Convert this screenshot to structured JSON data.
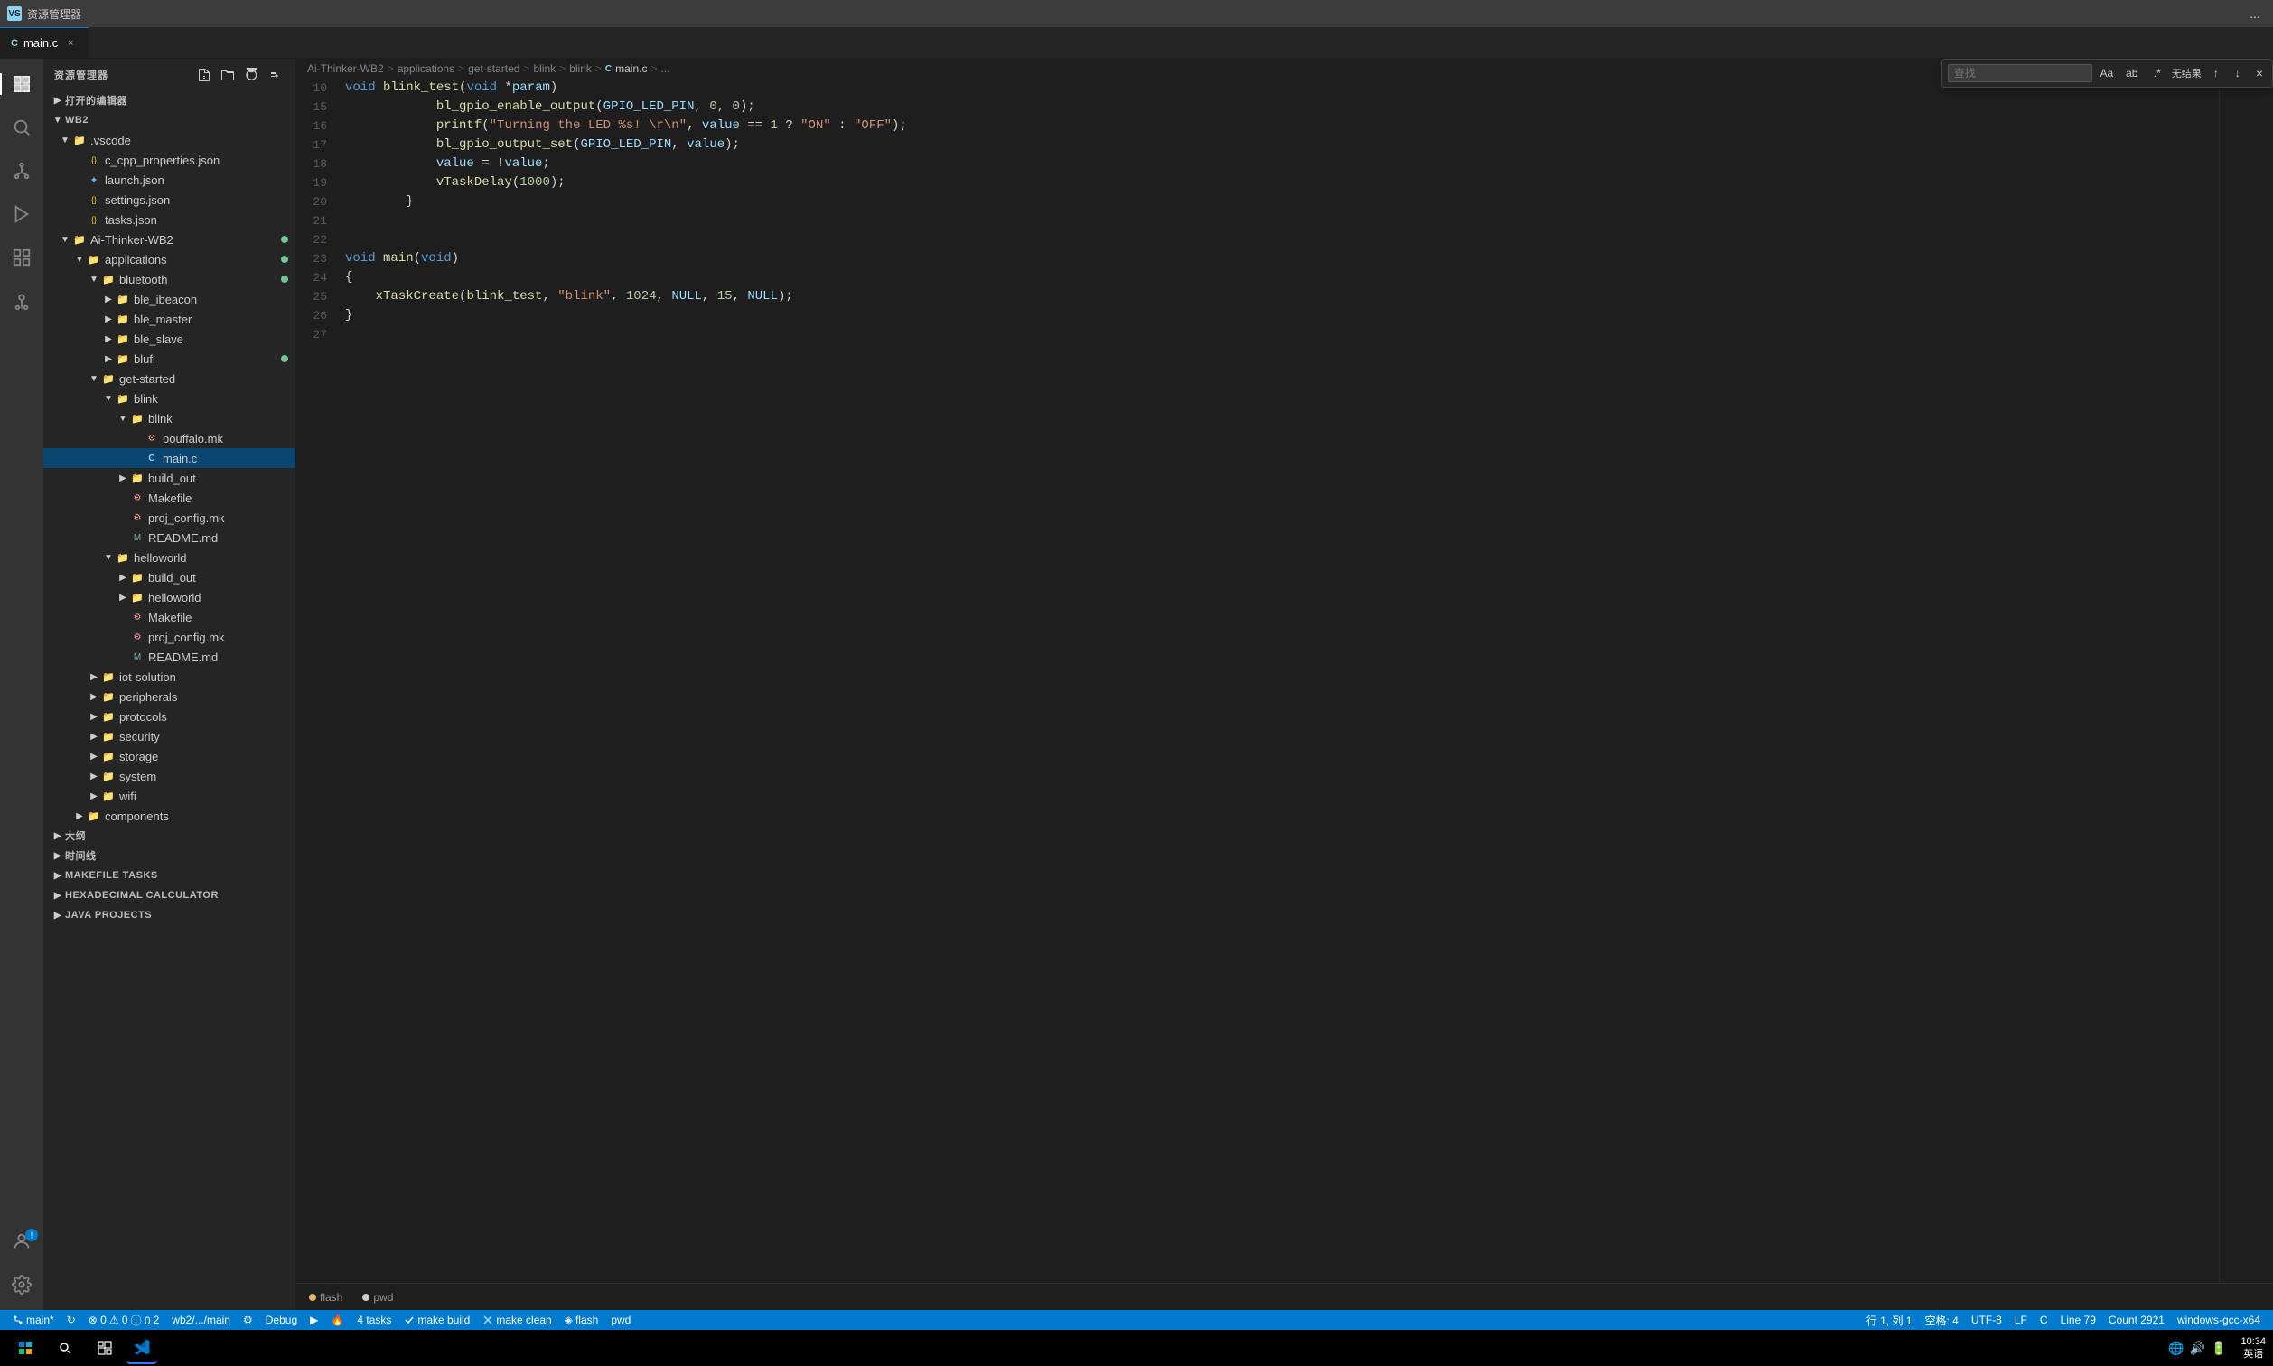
{
  "titleBar": {
    "icon": "VS",
    "title": "资源管理器",
    "dotsLabel": "..."
  },
  "tabs": [
    {
      "id": "main-c",
      "label": "main.c",
      "active": true,
      "icon": "C",
      "modified": false
    },
    {
      "id": "close",
      "label": "×"
    }
  ],
  "breadcrumb": {
    "items": [
      "Ai-Thinker-WB2",
      "applications",
      "get-started",
      "blink",
      "blink",
      "main.c",
      "..."
    ],
    "seps": [
      ">",
      ">",
      ">",
      ">",
      ">",
      ">"
    ]
  },
  "findBar": {
    "placeholder": "查找",
    "resultText": "无结果",
    "buttons": [
      "Aa",
      "ab",
      ".*"
    ]
  },
  "sidebar": {
    "header": "资源管理器",
    "openEditorHeader": "打开的编辑器",
    "sections": [
      {
        "label": "WB2",
        "expanded": true,
        "children": [
          {
            "label": ".vscode",
            "type": "folder",
            "depth": 1,
            "expanded": true
          },
          {
            "label": "c_cpp_properties.json",
            "type": "file-json",
            "depth": 2,
            "icon": "{}"
          },
          {
            "label": "launch.json",
            "type": "file-json",
            "depth": 2,
            "icon": "✦"
          },
          {
            "label": "settings.json",
            "type": "file-json",
            "depth": 2,
            "icon": "{}"
          },
          {
            "label": "tasks.json",
            "type": "file-json",
            "depth": 2,
            "icon": "{}"
          },
          {
            "label": "Ai-Thinker-WB2",
            "type": "folder",
            "depth": 1,
            "expanded": true,
            "dot": "green"
          },
          {
            "label": "applications",
            "type": "folder",
            "depth": 2,
            "expanded": true,
            "dot": "green"
          },
          {
            "label": "bluetooth",
            "type": "folder",
            "depth": 3,
            "expanded": true,
            "dot": "green"
          },
          {
            "label": "ble_ibeacon",
            "type": "folder",
            "depth": 4,
            "expanded": false
          },
          {
            "label": "ble_master",
            "type": "folder",
            "depth": 4,
            "expanded": false
          },
          {
            "label": "ble_slave",
            "type": "folder",
            "depth": 4,
            "expanded": false
          },
          {
            "label": "blufi",
            "type": "folder",
            "depth": 4,
            "expanded": false,
            "dot": "green"
          },
          {
            "label": "get-started",
            "type": "folder",
            "depth": 3,
            "expanded": true
          },
          {
            "label": "blink",
            "type": "folder",
            "depth": 4,
            "expanded": true
          },
          {
            "label": "blink",
            "type": "folder",
            "depth": 5,
            "expanded": true
          },
          {
            "label": "bouffalo.mk",
            "type": "file-mk",
            "depth": 6
          },
          {
            "label": "main.c",
            "type": "file-c",
            "depth": 6,
            "selected": true
          },
          {
            "label": "build_out",
            "type": "folder",
            "depth": 5,
            "expanded": false
          },
          {
            "label": "Makefile",
            "type": "file-mk",
            "depth": 5
          },
          {
            "label": "proj_config.mk",
            "type": "file-mk",
            "depth": 5
          },
          {
            "label": "README.md",
            "type": "file-md",
            "depth": 5
          },
          {
            "label": "helloworld",
            "type": "folder",
            "depth": 4,
            "expanded": true
          },
          {
            "label": "build_out",
            "type": "folder",
            "depth": 5,
            "expanded": false
          },
          {
            "label": "helloworld",
            "type": "folder",
            "depth": 5,
            "expanded": false
          },
          {
            "label": "Makefile",
            "type": "file-mk",
            "depth": 5
          },
          {
            "label": "proj_config.mk",
            "type": "file-mk",
            "depth": 5
          },
          {
            "label": "README.md",
            "type": "file-md",
            "depth": 5
          },
          {
            "label": "iot-solution",
            "type": "folder",
            "depth": 3,
            "expanded": false
          },
          {
            "label": "peripherals",
            "type": "folder",
            "depth": 3,
            "expanded": false
          },
          {
            "label": "protocols",
            "type": "folder",
            "depth": 3,
            "expanded": false
          },
          {
            "label": "security",
            "type": "folder",
            "depth": 3,
            "expanded": false
          },
          {
            "label": "storage",
            "type": "folder",
            "depth": 3,
            "expanded": false
          },
          {
            "label": "system",
            "type": "folder",
            "depth": 3,
            "expanded": false
          },
          {
            "label": "wifi",
            "type": "folder",
            "depth": 3,
            "expanded": false
          },
          {
            "label": "components",
            "type": "folder",
            "depth": 2,
            "expanded": false
          }
        ]
      }
    ],
    "bottomSections": [
      {
        "label": "大纲"
      },
      {
        "label": "时间线"
      },
      {
        "label": "MAKEFILE TASKS"
      },
      {
        "label": "HEXADECIMAL CALCULATOR"
      },
      {
        "label": "JAVA PROJECTS"
      }
    ]
  },
  "codeLines": [
    {
      "num": 10,
      "content": "void blink_test(void *param)"
    },
    {
      "num": 15,
      "content": "    bl_gpio_enable_output(GPIO_LED_PIN, 0, 0);"
    },
    {
      "num": 16,
      "content": "    printf(\"Turning the LED %s! \\r\\n\", value == 1 ? \"ON\" : \"OFF\");"
    },
    {
      "num": 17,
      "content": "    bl_gpio_output_set(GPIO_LED_PIN, value);"
    },
    {
      "num": 18,
      "content": "    value = !value;"
    },
    {
      "num": 19,
      "content": "    vTaskDelay(1000);"
    },
    {
      "num": 20,
      "content": "}"
    },
    {
      "num": 21,
      "content": ""
    },
    {
      "num": 22,
      "content": ""
    },
    {
      "num": 23,
      "content": "void main(void)"
    },
    {
      "num": 24,
      "content": "{"
    },
    {
      "num": 25,
      "content": "    xTaskCreate(blink_test, \"blink\", 1024, NULL, 15, NULL);"
    },
    {
      "num": 26,
      "content": "}"
    },
    {
      "num": 27,
      "content": ""
    }
  ],
  "statusBar": {
    "branch": "main*",
    "syncIcon": "↻",
    "errors": "⊗ 0",
    "warnings": "⚠ 0",
    "info": "ⓘ 0",
    "notif": "2",
    "wb2branch": "wb2/.../main",
    "debug": "Debug",
    "debugIcon": "⚙",
    "runIcon": "▶",
    "fireIcon": "🔥",
    "taskCount": "4 tasks",
    "makeBuild": "make build",
    "makeClean": "make clean",
    "flash": "flash",
    "pwd": "pwd",
    "flashIcon": "◈",
    "cursor": "行 1, 列 1",
    "spaces": "空格: 4",
    "encoding": "UTF-8",
    "lineEnding": "LF",
    "fileType": "C",
    "lineNum": "Line 79",
    "wordCount": "Count 2921",
    "compiler": "windows-gcc-x64",
    "time": "10:34"
  },
  "terminalTabs": [
    {
      "label": "flash",
      "color": "orange",
      "active": false
    },
    {
      "label": "pwd",
      "color": "white",
      "active": false
    }
  ]
}
